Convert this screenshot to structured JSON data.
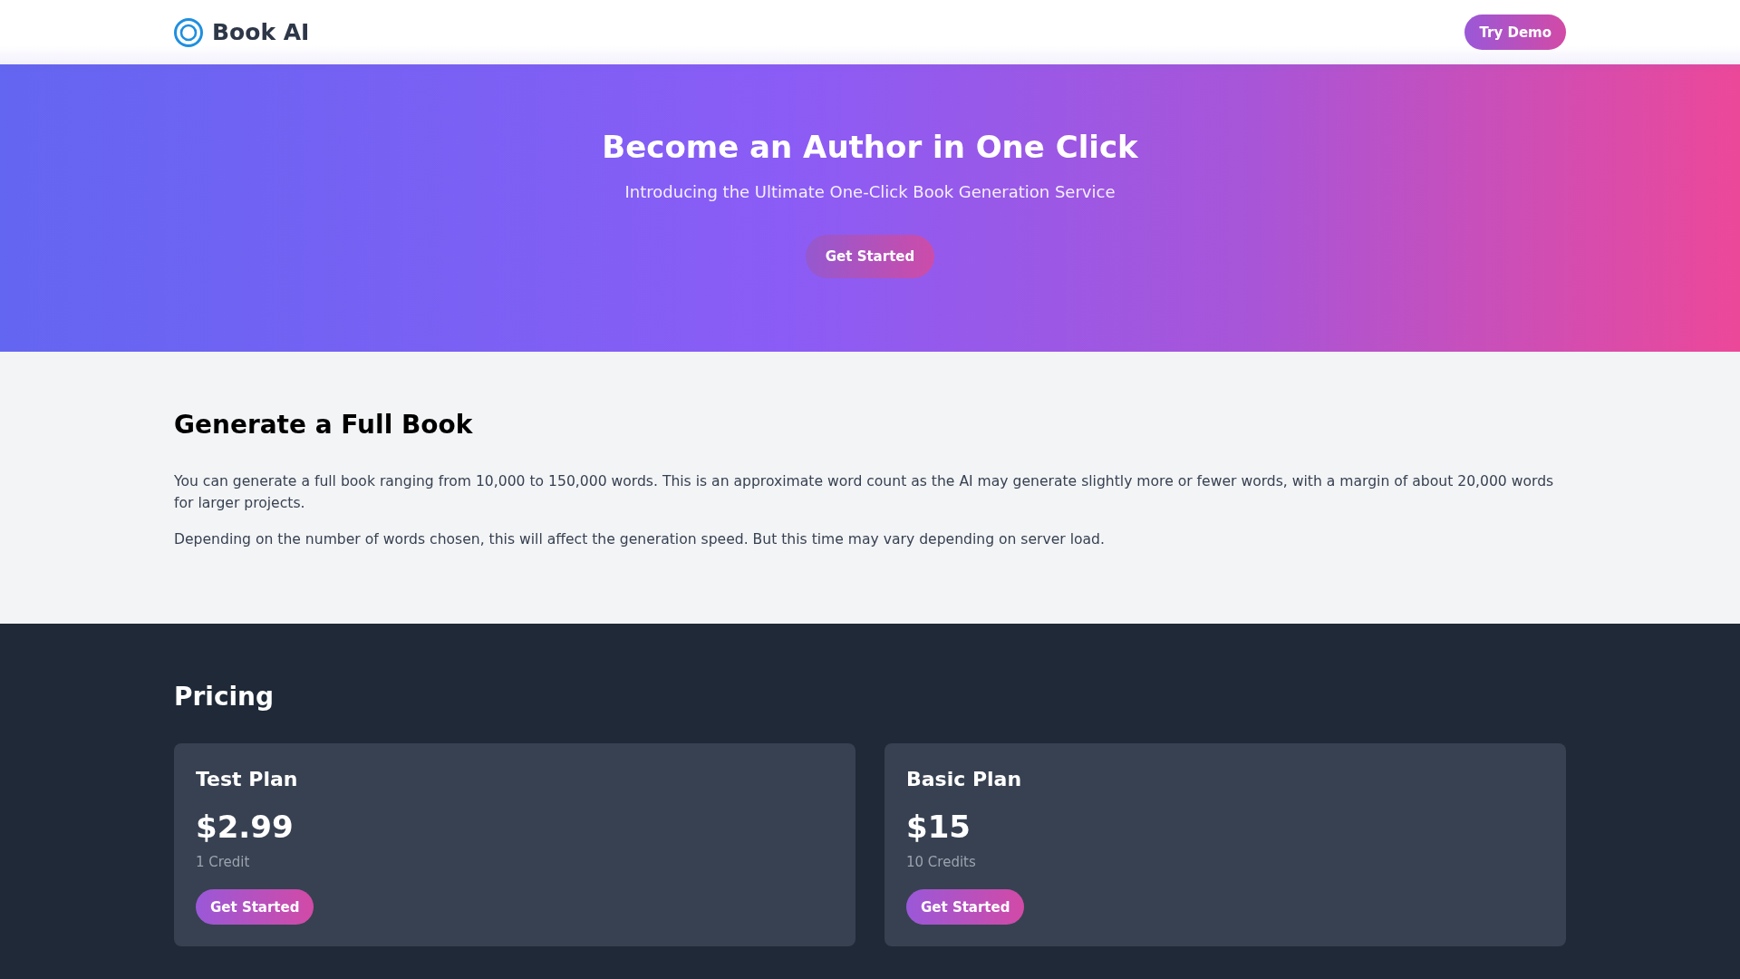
{
  "header": {
    "logo_text": "Book AI",
    "demo_button": "Try Demo"
  },
  "hero": {
    "title": "Become an Author in One Click",
    "subtitle": "Introducing the Ultimate One-Click Book Generation Service",
    "button": "Get Started"
  },
  "feature": {
    "heading": "Generate a Full Book",
    "paragraphs": [
      "You can generate a full book ranging from 10,000 to 150,000 words. This is an approximate word count as the AI may generate slightly more or fewer words, with a margin of about 20,000 words for larger projects.",
      "Depending on the number of words chosen, this will affect the generation speed. But this time may vary depending on server load."
    ]
  },
  "pricing": {
    "heading": "Pricing",
    "plans": [
      {
        "name": "Test Plan",
        "price": "$2.99",
        "credits": "1 Credit",
        "button": "Get Started"
      },
      {
        "name": "Basic Plan",
        "price": "$15",
        "credits": "10 Credits",
        "button": "Get Started"
      }
    ]
  }
}
